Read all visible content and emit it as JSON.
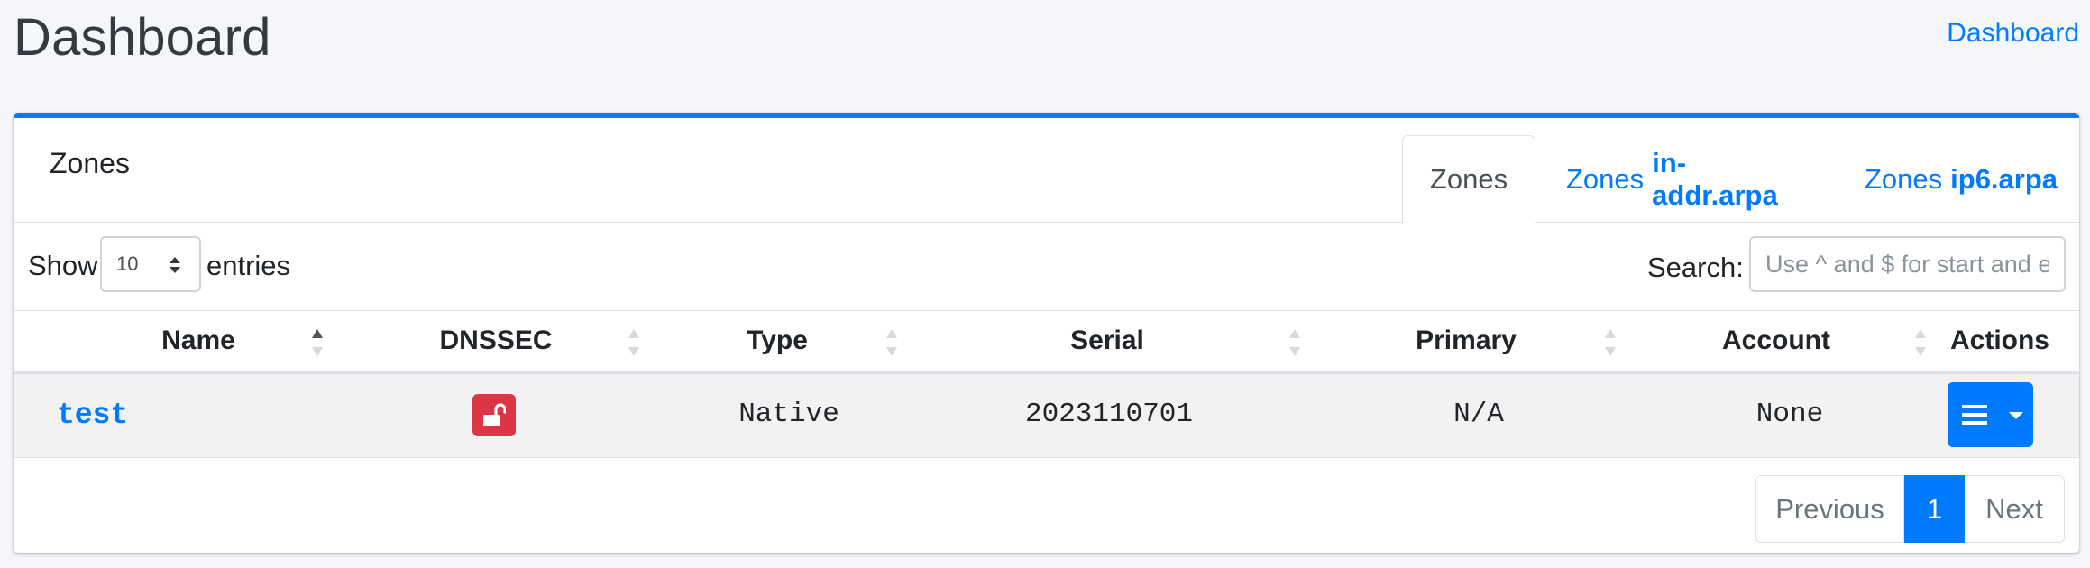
{
  "header": {
    "title": "Dashboard",
    "breadcrumb": "Dashboard"
  },
  "card": {
    "title": "Zones",
    "tabs": [
      {
        "label": "Zones",
        "bold": ""
      },
      {
        "label": "Zones",
        "bold": "in-addr.arpa"
      },
      {
        "label": "Zones",
        "bold": "ip6.arpa"
      }
    ]
  },
  "controls": {
    "show_label": "Show",
    "page_length": "10",
    "entries_label": "entries",
    "search_label": "Search:",
    "search_placeholder": "Use ^ and $ for start and end"
  },
  "table": {
    "columns": [
      "Name",
      "DNSSEC",
      "Type",
      "Serial",
      "Primary",
      "Account",
      "Actions"
    ],
    "rows": [
      {
        "name": "test",
        "dnssec": "unlocked-icon",
        "type": "Native",
        "serial": "2023110701",
        "primary": "N/A",
        "account": "None"
      }
    ]
  },
  "pagination": {
    "previous": "Previous",
    "current": "1",
    "next": "Next"
  },
  "colors": {
    "accent": "#007bff",
    "danger": "#dc3545"
  }
}
